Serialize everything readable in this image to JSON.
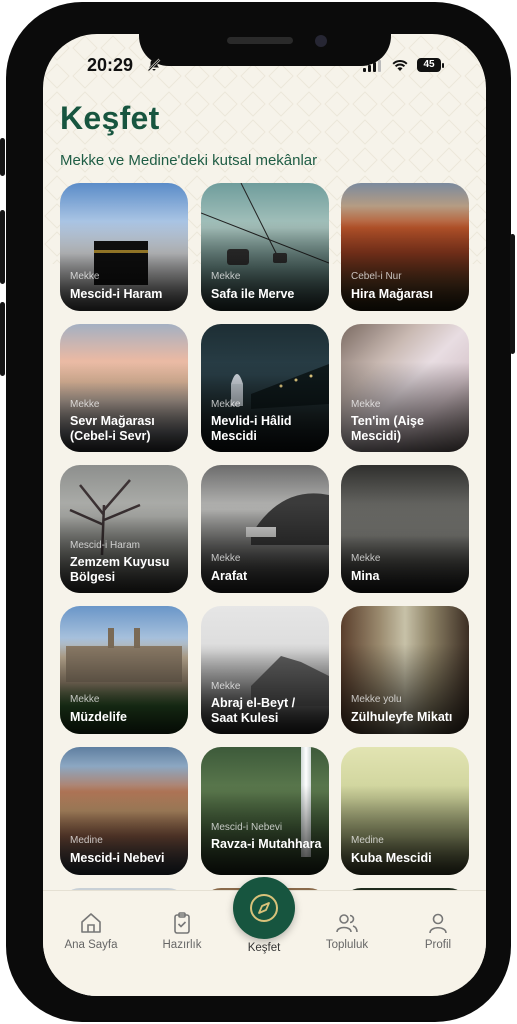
{
  "status": {
    "time": "20:29",
    "battery": "45"
  },
  "header": {
    "title": "Keşfet",
    "subtitle": "Mekke ve Medine'deki kutsal mekânlar"
  },
  "places": [
    {
      "location": "Mekke",
      "name": "Mescid-i Haram"
    },
    {
      "location": "Mekke",
      "name": "Safa ile Merve"
    },
    {
      "location": "Cebel-i Nur",
      "name": "Hira Mağarası"
    },
    {
      "location": "Mekke",
      "name": "Sevr Mağarası (Cebel-i Sevr)"
    },
    {
      "location": "Mekke",
      "name": "Mevlid-i Hâlid Mescidi"
    },
    {
      "location": "Mekke",
      "name": "Ten'im (Aişe Mescidi)"
    },
    {
      "location": "Mescid-i Haram",
      "name": "Zemzem Kuyusu Bölgesi"
    },
    {
      "location": "Mekke",
      "name": "Arafat"
    },
    {
      "location": "Mekke",
      "name": "Mina"
    },
    {
      "location": "Mekke",
      "name": "Müzdelife"
    },
    {
      "location": "Mekke",
      "name": "Abraj el-Beyt / Saat Kulesi"
    },
    {
      "location": "Mekke yolu",
      "name": "Zülhuleyfe Mikatı"
    },
    {
      "location": "Medine",
      "name": "Mescid-i Nebevi"
    },
    {
      "location": "Mescid-i Nebevi",
      "name": "Ravza-i Mutahhara"
    },
    {
      "location": "Medine",
      "name": "Kuba Mescidi"
    }
  ],
  "tabs": [
    {
      "label": "Ana Sayfa",
      "icon": "home-icon"
    },
    {
      "label": "Hazırlık",
      "icon": "clipboard-check-icon"
    },
    {
      "label": "Keşfet",
      "icon": "compass-icon",
      "active": true
    },
    {
      "label": "Topluluk",
      "icon": "users-icon"
    },
    {
      "label": "Profil",
      "icon": "user-icon"
    }
  ],
  "colors": {
    "accent": "#17553f",
    "background": "#f6f3ea"
  }
}
